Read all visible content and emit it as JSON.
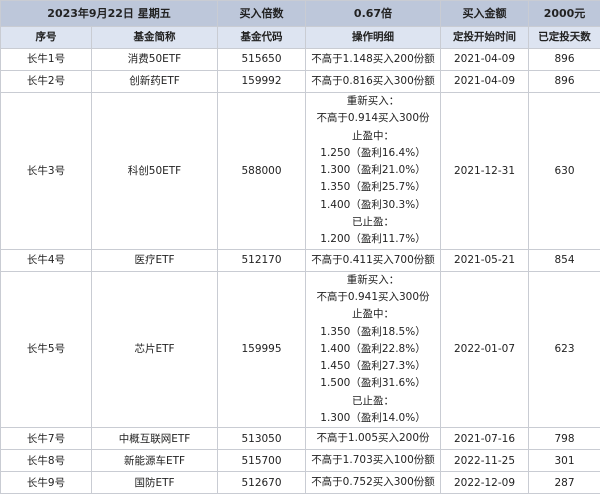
{
  "header": {
    "date": "2023年9月22日 星期五",
    "multiplier_label": "买入倍数",
    "multiplier_value": "0.67倍",
    "amount_label": "买入金额",
    "amount_value": "2000元"
  },
  "columns": [
    "序号",
    "基金简称",
    "基金代码",
    "操作明细",
    "定投开始时间",
    "已定投天数"
  ],
  "rows": [
    {
      "id": "长牛1号",
      "name": "消费50ETF",
      "code": "515650",
      "ops": [
        "不高于1.148买入200份额"
      ],
      "start": "2021-04-09",
      "days": "896"
    },
    {
      "id": "长牛2号",
      "name": "创新药ETF",
      "code": "159992",
      "ops": [
        "不高于0.816买入300份额"
      ],
      "start": "2021-04-09",
      "days": "896"
    },
    {
      "id": "长牛3号",
      "name": "科创50ETF",
      "code": "588000",
      "ops": [
        "重新买入：",
        "不高于0.914买入300份",
        "止盈中：",
        "1.250（盈利16.4%）",
        "1.300（盈利21.0%）",
        "1.350（盈利25.7%）",
        "1.400（盈利30.3%）",
        "已止盈：",
        "1.200（盈利11.7%）"
      ],
      "start": "2021-12-31",
      "days": "630"
    },
    {
      "id": "长牛4号",
      "name": "医疗ETF",
      "code": "512170",
      "ops": [
        "不高于0.411买入700份额"
      ],
      "start": "2021-05-21",
      "days": "854"
    },
    {
      "id": "长牛5号",
      "name": "芯片ETF",
      "code": "159995",
      "ops": [
        "重新买入：",
        "不高于0.941买入300份",
        "止盈中：",
        "1.350（盈利18.5%）",
        "1.400（盈利22.8%）",
        "1.450（盈利27.3%）",
        "1.500（盈利31.6%）",
        "已止盈：",
        "1.300（盈利14.0%）"
      ],
      "start": "2022-01-07",
      "days": "623"
    },
    {
      "id": "长牛7号",
      "name": "中概互联网ETF",
      "code": "513050",
      "ops": [
        "不高于1.005买入200份"
      ],
      "start": "2021-07-16",
      "days": "798"
    },
    {
      "id": "长牛8号",
      "name": "新能源车ETF",
      "code": "515700",
      "ops": [
        "不高于1.703买入100份额"
      ],
      "start": "2022-11-25",
      "days": "301"
    },
    {
      "id": "长牛9号",
      "name": "国防ETF",
      "code": "512670",
      "ops": [
        "不高于0.752买入300份额"
      ],
      "start": "2022-12-09",
      "days": "287"
    }
  ]
}
